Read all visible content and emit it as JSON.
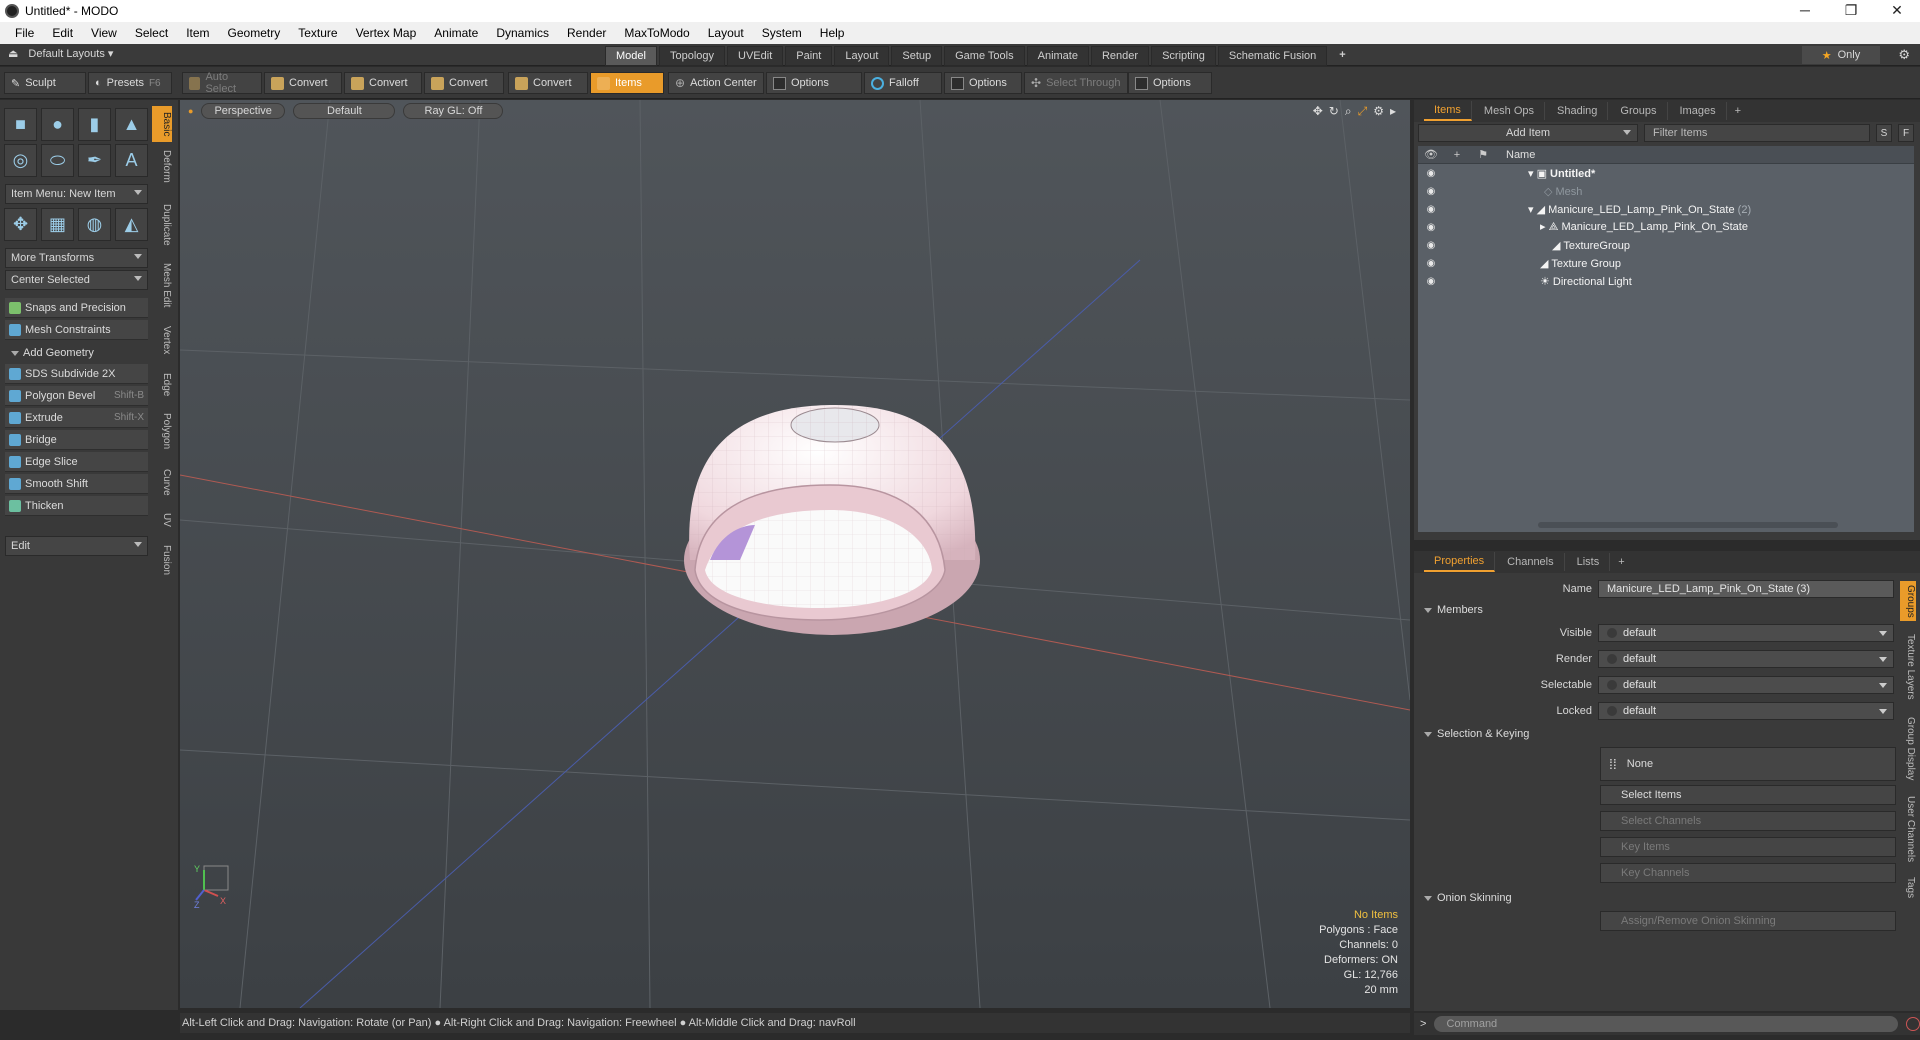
{
  "window": {
    "title": "Untitled* - MODO",
    "minimize": "─",
    "maximize": "❐",
    "close": "✕"
  },
  "menu": [
    "File",
    "Edit",
    "View",
    "Select",
    "Item",
    "Geometry",
    "Texture",
    "Vertex Map",
    "Animate",
    "Dynamics",
    "Render",
    "MaxToModo",
    "Layout",
    "System",
    "Help"
  ],
  "layoutbar": {
    "layouts_label": "Default Layouts",
    "tabs": [
      "Model",
      "Topology",
      "UVEdit",
      "Paint",
      "Layout",
      "Setup",
      "Game Tools",
      "Animate",
      "Render",
      "Scripting",
      "Schematic Fusion"
    ],
    "active_tab": "Model",
    "plus": "+",
    "only_label": "Only"
  },
  "toolbar": {
    "sculpt": "Sculpt",
    "presets": "Presets",
    "presets_shortcut": "F6",
    "auto_select": "Auto Select",
    "convert1": "Convert",
    "convert2": "Convert",
    "convert3": "Convert",
    "convert4": "Convert",
    "items": "Items",
    "action_center": "Action Center",
    "options1": "Options",
    "falloff": "Falloff",
    "options2": "Options",
    "select_through": "Select Through",
    "options3": "Options"
  },
  "toolbox": {
    "vtabs": [
      "Basic",
      "Deform",
      "Duplicate",
      "Mesh Edit",
      "Vertex",
      "Edge",
      "Polygon",
      "Curve",
      "UV",
      "Fusion"
    ],
    "item_menu": "Item Menu: New Item",
    "more_transforms": "More Transforms",
    "center_selected": "Center Selected",
    "snaps": "Snaps and Precision",
    "mesh_constraints": "Mesh Constraints",
    "add_geometry": "Add Geometry",
    "tools": [
      {
        "label": "SDS Subdivide 2X",
        "shortcut": ""
      },
      {
        "label": "Polygon Bevel",
        "shortcut": "Shift-B"
      },
      {
        "label": "Extrude",
        "shortcut": "Shift-X"
      },
      {
        "label": "Bridge",
        "shortcut": ""
      },
      {
        "label": "Edge Slice",
        "shortcut": ""
      },
      {
        "label": "Smooth Shift",
        "shortcut": ""
      },
      {
        "label": "Thicken",
        "shortcut": ""
      }
    ],
    "edit": "Edit"
  },
  "viewport": {
    "view": "Perspective",
    "shading": "Default",
    "raygl": "Ray GL: Off",
    "info": {
      "no_items": "No Items",
      "polygons": "Polygons : Face",
      "channels": "Channels: 0",
      "deformers": "Deformers: ON",
      "gl": "GL: 12,766",
      "scale": "20 mm"
    },
    "axis_x": "X",
    "axis_y": "Y",
    "axis_z": "Z"
  },
  "statusbar": "Alt-Left Click and Drag: Navigation: Rotate (or Pan) ● Alt-Right Click and Drag: Navigation: Freewheel ● Alt-Middle Click and Drag: navRoll",
  "items_panel": {
    "tabs": [
      "Items",
      "Mesh Ops",
      "Shading",
      "Groups",
      "Images"
    ],
    "active_tab": "Items",
    "add_item": "Add Item",
    "filter": "Filter Items",
    "btn_s": "S",
    "btn_f": "F",
    "col_name": "Name",
    "rows": [
      {
        "label": "Untitled*",
        "count": "",
        "style": "bold"
      },
      {
        "label": "Mesh",
        "count": "",
        "style": "dim"
      },
      {
        "label": "Manicure_LED_Lamp_Pink_On_State",
        "count": "(2)",
        "style": "normal"
      },
      {
        "label": "Manicure_LED_Lamp_Pink_On_State",
        "count": "",
        "style": "normal"
      },
      {
        "label": "TextureGroup",
        "count": "",
        "style": "normal"
      },
      {
        "label": "Texture Group",
        "count": "",
        "style": "normal"
      },
      {
        "label": "Directional Light",
        "count": "",
        "style": "normal"
      }
    ]
  },
  "props_panel": {
    "tabs": [
      "Properties",
      "Channels",
      "Lists"
    ],
    "active_tab": "Properties",
    "name_label": "Name",
    "name_value": "Manicure_LED_Lamp_Pink_On_State (3)",
    "members": "Members",
    "visible_label": "Visible",
    "visible": "default",
    "render_label": "Render",
    "render": "default",
    "selectable_label": "Selectable",
    "selectable": "default",
    "locked_label": "Locked",
    "locked": "default",
    "selection_keying": "Selection & Keying",
    "none": "None",
    "select_items": "Select Items",
    "select_channels": "Select Channels",
    "key_items": "Key Items",
    "key_channels": "Key Channels",
    "onion": "Onion Skinning",
    "assign_onion": "Assign/Remove Onion Skinning",
    "vtabs": [
      "Groups",
      "Texture Layers",
      "Group Display",
      "User Channels",
      "Tags"
    ]
  },
  "command": {
    "placeholder": "Command"
  },
  "colors": {
    "accent": "#e99b2a",
    "viewport_bg": "#4a4e52",
    "model_pink": "#f3dde2"
  }
}
